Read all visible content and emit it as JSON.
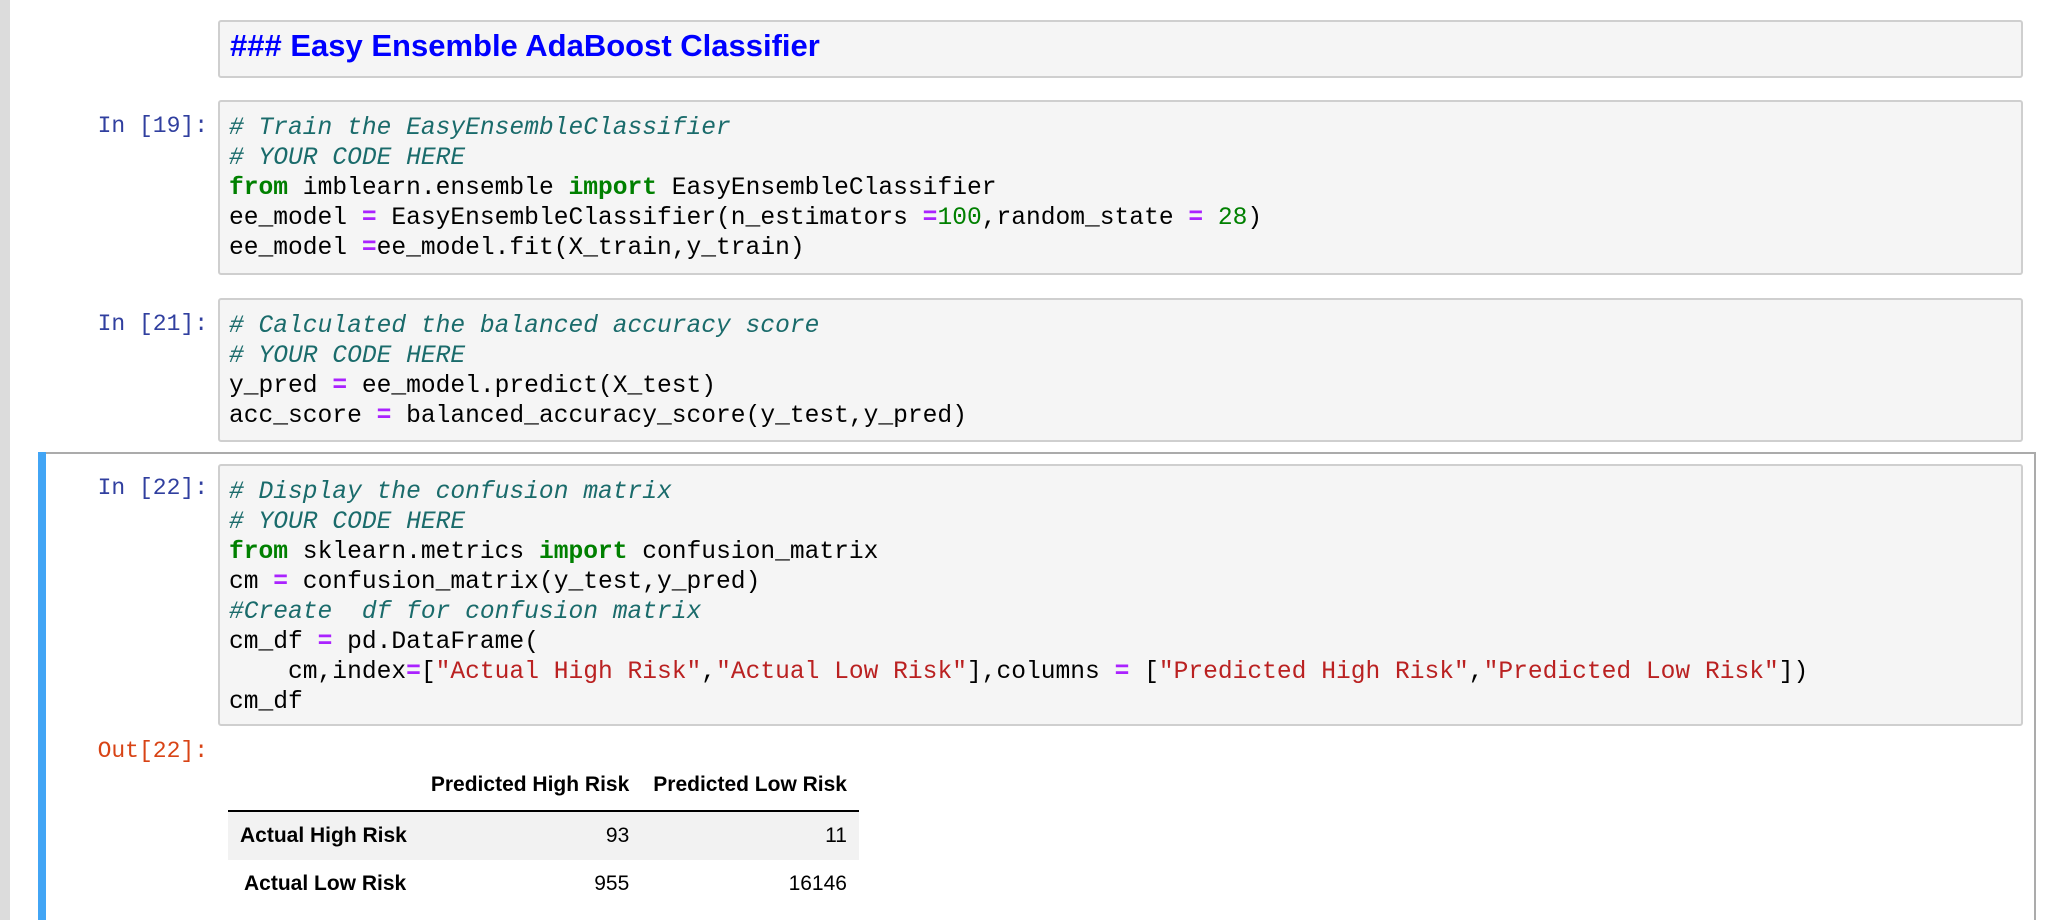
{
  "markdown_cell": {
    "heading": "### Easy Ensemble AdaBoost Classifier"
  },
  "cell_19": {
    "prompt": "In [19]:",
    "lines": [
      [
        {
          "t": "# Train the EasyEnsembleClassifier",
          "c": "cm"
        }
      ],
      [
        {
          "t": "# YOUR CODE HERE",
          "c": "cm"
        }
      ],
      [
        {
          "t": "from",
          "c": "kw"
        },
        {
          "t": " imblearn.ensemble ",
          "c": ""
        },
        {
          "t": "import",
          "c": "kw"
        },
        {
          "t": " EasyEnsembleClassifier",
          "c": ""
        }
      ],
      [
        {
          "t": "ee_model ",
          "c": ""
        },
        {
          "t": "=",
          "c": "op"
        },
        {
          "t": " EasyEnsembleClassifier(n_estimators ",
          "c": ""
        },
        {
          "t": "=",
          "c": "op"
        },
        {
          "t": "100",
          "c": "num"
        },
        {
          "t": ",random_state ",
          "c": ""
        },
        {
          "t": "=",
          "c": "op"
        },
        {
          "t": " ",
          "c": ""
        },
        {
          "t": "28",
          "c": "num"
        },
        {
          "t": ")",
          "c": ""
        }
      ],
      [
        {
          "t": "ee_model ",
          "c": ""
        },
        {
          "t": "=",
          "c": "op"
        },
        {
          "t": "ee_model.fit(X_train,y_train)",
          "c": ""
        }
      ]
    ]
  },
  "cell_21": {
    "prompt": "In [21]:",
    "lines": [
      [
        {
          "t": "# Calculated the balanced accuracy score",
          "c": "cm"
        }
      ],
      [
        {
          "t": "# YOUR CODE HERE",
          "c": "cm"
        }
      ],
      [
        {
          "t": "y_pred ",
          "c": ""
        },
        {
          "t": "=",
          "c": "op"
        },
        {
          "t": " ee_model.predict(X_test)",
          "c": ""
        }
      ],
      [
        {
          "t": "acc_score ",
          "c": ""
        },
        {
          "t": "=",
          "c": "op"
        },
        {
          "t": " balanced_accuracy_score(y_test,y_pred)",
          "c": ""
        }
      ]
    ]
  },
  "cell_22": {
    "prompt": "In [22]:",
    "out_prompt": "Out[22]:",
    "lines": [
      [
        {
          "t": "# Display the confusion matrix",
          "c": "cm"
        }
      ],
      [
        {
          "t": "# YOUR CODE HERE",
          "c": "cm"
        }
      ],
      [
        {
          "t": "from",
          "c": "kw"
        },
        {
          "t": " sklearn.metrics ",
          "c": ""
        },
        {
          "t": "import",
          "c": "kw"
        },
        {
          "t": " confusion_matrix",
          "c": ""
        }
      ],
      [
        {
          "t": "cm ",
          "c": ""
        },
        {
          "t": "=",
          "c": "op"
        },
        {
          "t": " confusion_matrix(y_test,y_pred)",
          "c": ""
        }
      ],
      [
        {
          "t": "#Create  df for confusion matrix",
          "c": "cm"
        }
      ],
      [
        {
          "t": "cm_df ",
          "c": ""
        },
        {
          "t": "=",
          "c": "op"
        },
        {
          "t": " pd.DataFrame(",
          "c": ""
        }
      ],
      [
        {
          "t": "    cm,index",
          "c": ""
        },
        {
          "t": "=",
          "c": "op"
        },
        {
          "t": "[",
          "c": ""
        },
        {
          "t": "\"Actual High Risk\"",
          "c": "str"
        },
        {
          "t": ",",
          "c": ""
        },
        {
          "t": "\"Actual Low Risk\"",
          "c": "str"
        },
        {
          "t": "],columns ",
          "c": ""
        },
        {
          "t": "=",
          "c": "op"
        },
        {
          "t": " [",
          "c": ""
        },
        {
          "t": "\"Predicted High Risk\"",
          "c": "str"
        },
        {
          "t": ",",
          "c": ""
        },
        {
          "t": "\"Predicted Low Risk\"",
          "c": "str"
        },
        {
          "t": "])",
          "c": ""
        }
      ],
      [
        {
          "t": "cm_df",
          "c": ""
        }
      ]
    ],
    "output_table": {
      "columns": [
        "",
        "Predicted High Risk",
        "Predicted Low Risk"
      ],
      "rows": [
        {
          "label": "Actual High Risk",
          "values": [
            "93",
            "11"
          ]
        },
        {
          "label": "Actual Low Risk",
          "values": [
            "955",
            "16146"
          ]
        }
      ]
    }
  },
  "colors": {
    "selected_cell_bar": "#42a5f5",
    "in_prompt": "#303f9f",
    "out_prompt": "#d84315",
    "heading": "#0000ff"
  }
}
